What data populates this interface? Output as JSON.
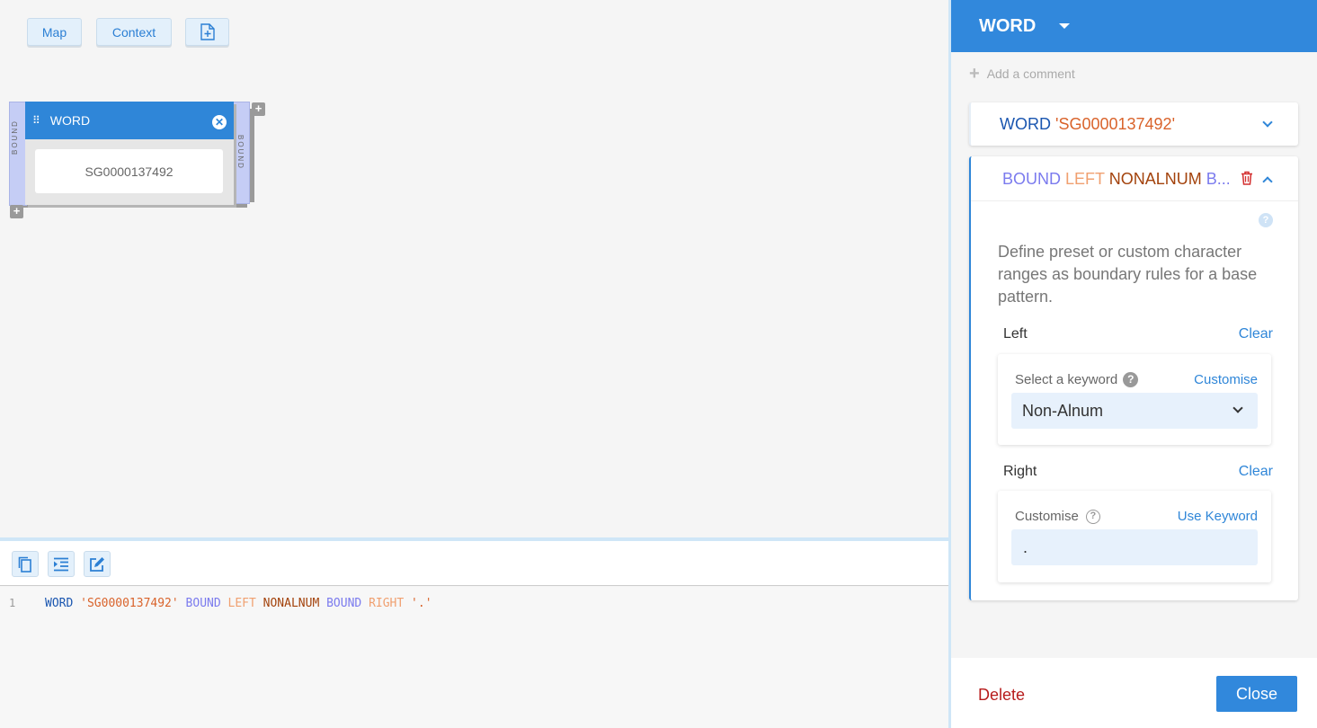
{
  "toolbar": {
    "map_label": "Map",
    "context_label": "Context",
    "new_file_icon": "file-plus-icon"
  },
  "block": {
    "bound_label": "BOUND",
    "title": "WORD",
    "value": "SG0000137492"
  },
  "editor": {
    "toolbar_icons": [
      "copy-icon",
      "indent-icon",
      "edit-icon"
    ],
    "line_number": "1",
    "tokens": {
      "word": "WORD",
      "string": "'SG0000137492'",
      "bound1": "BOUND",
      "left": "LEFT",
      "nonalnum": "NONALNUM",
      "bound2": "BOUND",
      "right": "RIGHT",
      "dot": "'.'"
    }
  },
  "panel": {
    "title": "WORD",
    "add_comment": "Add a comment",
    "word_card": {
      "keyword": "WORD",
      "value": "'SG0000137492'"
    },
    "bound_card": {
      "bound": "BOUND",
      "left": "LEFT",
      "nonalnum": "NONALNUM",
      "more": "B..."
    },
    "description": "Define preset or custom character ranges as boundary rules for a base pattern.",
    "left_section": {
      "label": "Left",
      "clear": "Clear",
      "select_label": "Select a keyword",
      "customise_link": "Customise",
      "selected": "Non-Alnum"
    },
    "right_section": {
      "label": "Right",
      "clear": "Clear",
      "customise_label": "Customise",
      "use_keyword_link": "Use Keyword",
      "value": "."
    },
    "delete_label": "Delete",
    "close_label": "Close"
  },
  "colors": {
    "accent": "#3188dc",
    "keyword": "#1a56b0",
    "string": "#d9632b",
    "bound": "#7b7bee",
    "left": "#f0a070",
    "nonalnum": "#a3420b",
    "delete": "#b71c1c"
  }
}
